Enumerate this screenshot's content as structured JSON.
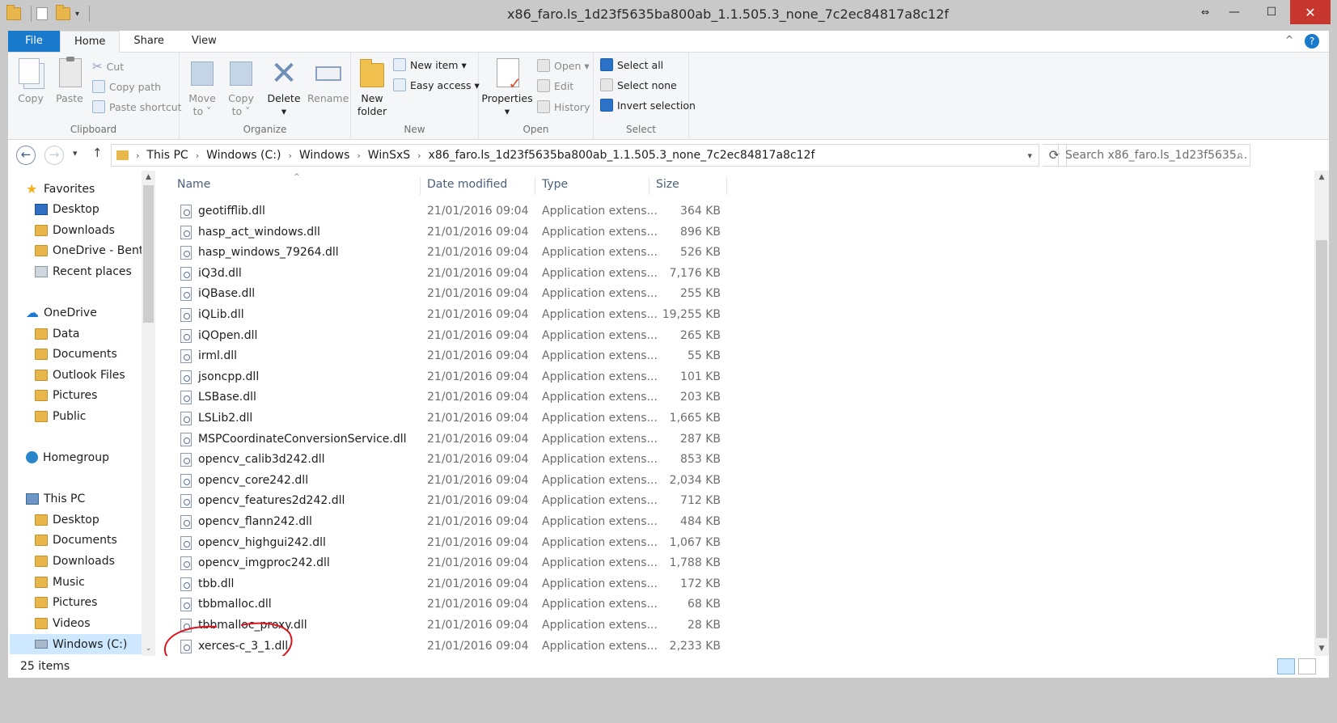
{
  "window": {
    "title": "x86_faro.ls_1d23f5635ba800ab_1.1.505.3_none_7c2ec84817a8c12f"
  },
  "window_controls": {
    "resize_glyph": "⇔",
    "minimize": "—",
    "maximize": "☐",
    "close": "✕"
  },
  "ribbon_tabs": [
    "File",
    "Home",
    "Share",
    "View"
  ],
  "ribbon_right": {
    "collapse": "^",
    "help": "?"
  },
  "clipboard": {
    "copy": "Copy",
    "paste": "Paste",
    "cut": "Cut",
    "copy_path": "Copy path",
    "paste_shortcut": "Paste shortcut",
    "label": "Clipboard"
  },
  "organize": {
    "move_to": "Move\nto ˅",
    "copy_to": "Copy\nto ˅",
    "delete": "Delete",
    "rename": "Rename",
    "label": "Organize",
    "move_to_l1": "Move",
    "move_to_l2": "to ˅",
    "copy_to_l1": "Copy",
    "copy_to_l2": "to ˅",
    "delete_arrow": "▾"
  },
  "new": {
    "new_folder_l1": "New",
    "new_folder_l2": "folder",
    "new_item": "New item ▾",
    "easy_access": "Easy access ▾",
    "label": "New"
  },
  "open": {
    "properties": "Properties",
    "properties_arrow": "▾",
    "open": "Open ▾",
    "edit": "Edit",
    "history": "History",
    "label": "Open"
  },
  "select": {
    "select_all": "Select all",
    "select_none": "Select none",
    "invert_selection": "Invert selection",
    "label": "Select"
  },
  "address": {
    "back": "←",
    "forward": "→",
    "recent": "▾",
    "up": "↑",
    "crumbs": [
      "This PC",
      "Windows (C:)",
      "Windows",
      "WinSxS",
      "x86_faro.ls_1d23f5635ba800ab_1.1.505.3_none_7c2ec84817a8c12f"
    ],
    "separator": "›",
    "dropdown": "▾",
    "refresh": "⟳",
    "search_placeholder": "Search x86_faro.ls_1d23f5635...",
    "search_icon": "⌕"
  },
  "nav_pane": {
    "items": [
      {
        "label": "Favorites",
        "icon": "star-icon"
      },
      {
        "label": "Desktop",
        "icon": "desktop-icon"
      },
      {
        "label": "Downloads",
        "icon": "folder-icon"
      },
      {
        "label": "OneDrive - Bentle",
        "icon": "folder-icon"
      },
      {
        "label": "Recent places",
        "icon": "recent-places-icon"
      },
      {
        "label": "OneDrive",
        "icon": "cloud-icon"
      },
      {
        "label": "Data",
        "icon": "folder-icon"
      },
      {
        "label": "Documents",
        "icon": "folder-icon"
      },
      {
        "label": "Outlook Files",
        "icon": "folder-icon"
      },
      {
        "label": "Pictures",
        "icon": "folder-icon"
      },
      {
        "label": "Public",
        "icon": "folder-icon"
      },
      {
        "label": "Homegroup",
        "icon": "homegroup-icon"
      },
      {
        "label": "This PC",
        "icon": "computer-icon"
      },
      {
        "label": "Desktop",
        "icon": "folder-icon"
      },
      {
        "label": "Documents",
        "icon": "folder-icon"
      },
      {
        "label": "Downloads",
        "icon": "folder-icon"
      },
      {
        "label": "Music",
        "icon": "folder-icon"
      },
      {
        "label": "Pictures",
        "icon": "folder-icon"
      },
      {
        "label": "Videos",
        "icon": "folder-icon"
      },
      {
        "label": "Windows (C:)",
        "icon": "drive-icon"
      }
    ]
  },
  "columns": {
    "name": "Name",
    "date": "Date modified",
    "type": "Type",
    "size": "Size",
    "sort_indicator": "^"
  },
  "scroll_arrows": {
    "up": "▲",
    "down": "▼",
    "nav_down": "⌄"
  },
  "files": [
    {
      "name": "geotifflib.dll",
      "date": "21/01/2016 09:04",
      "type": "Application extens...",
      "size": "364 KB"
    },
    {
      "name": "hasp_act_windows.dll",
      "date": "21/01/2016 09:04",
      "type": "Application extens...",
      "size": "896 KB"
    },
    {
      "name": "hasp_windows_79264.dll",
      "date": "21/01/2016 09:04",
      "type": "Application extens...",
      "size": "526 KB"
    },
    {
      "name": "iQ3d.dll",
      "date": "21/01/2016 09:04",
      "type": "Application extens...",
      "size": "7,176 KB"
    },
    {
      "name": "iQBase.dll",
      "date": "21/01/2016 09:04",
      "type": "Application extens...",
      "size": "255 KB"
    },
    {
      "name": "iQLib.dll",
      "date": "21/01/2016 09:04",
      "type": "Application extens...",
      "size": "19,255 KB"
    },
    {
      "name": "iQOpen.dll",
      "date": "21/01/2016 09:04",
      "type": "Application extens...",
      "size": "265 KB"
    },
    {
      "name": "irml.dll",
      "date": "21/01/2016 09:04",
      "type": "Application extens...",
      "size": "55 KB"
    },
    {
      "name": "jsoncpp.dll",
      "date": "21/01/2016 09:04",
      "type": "Application extens...",
      "size": "101 KB"
    },
    {
      "name": "LSBase.dll",
      "date": "21/01/2016 09:04",
      "type": "Application extens...",
      "size": "203 KB"
    },
    {
      "name": "LSLib2.dll",
      "date": "21/01/2016 09:04",
      "type": "Application extens...",
      "size": "1,665 KB"
    },
    {
      "name": "MSPCoordinateConversionService.dll",
      "date": "21/01/2016 09:04",
      "type": "Application extens...",
      "size": "287 KB"
    },
    {
      "name": "opencv_calib3d242.dll",
      "date": "21/01/2016 09:04",
      "type": "Application extens...",
      "size": "853 KB"
    },
    {
      "name": "opencv_core242.dll",
      "date": "21/01/2016 09:04",
      "type": "Application extens...",
      "size": "2,034 KB"
    },
    {
      "name": "opencv_features2d242.dll",
      "date": "21/01/2016 09:04",
      "type": "Application extens...",
      "size": "712 KB"
    },
    {
      "name": "opencv_flann242.dll",
      "date": "21/01/2016 09:04",
      "type": "Application extens...",
      "size": "484 KB"
    },
    {
      "name": "opencv_highgui242.dll",
      "date": "21/01/2016 09:04",
      "type": "Application extens...",
      "size": "1,067 KB"
    },
    {
      "name": "opencv_imgproc242.dll",
      "date": "21/01/2016 09:04",
      "type": "Application extens...",
      "size": "1,788 KB"
    },
    {
      "name": "tbb.dll",
      "date": "21/01/2016 09:04",
      "type": "Application extens...",
      "size": "172 KB"
    },
    {
      "name": "tbbmalloc.dll",
      "date": "21/01/2016 09:04",
      "type": "Application extens...",
      "size": "68 KB"
    },
    {
      "name": "tbbmalloc_proxy.dll",
      "date": "21/01/2016 09:04",
      "type": "Application extens...",
      "size": "28 KB"
    },
    {
      "name": "xerces-c_3_1.dll",
      "date": "21/01/2016 09:04",
      "type": "Application extens...",
      "size": "2,233 KB"
    }
  ],
  "status": {
    "item_count": "25 items"
  },
  "colors": {
    "accent": "#1979ca",
    "close": "#c7372f",
    "annotation": "#e0141e",
    "folder": "#e8b64a"
  }
}
